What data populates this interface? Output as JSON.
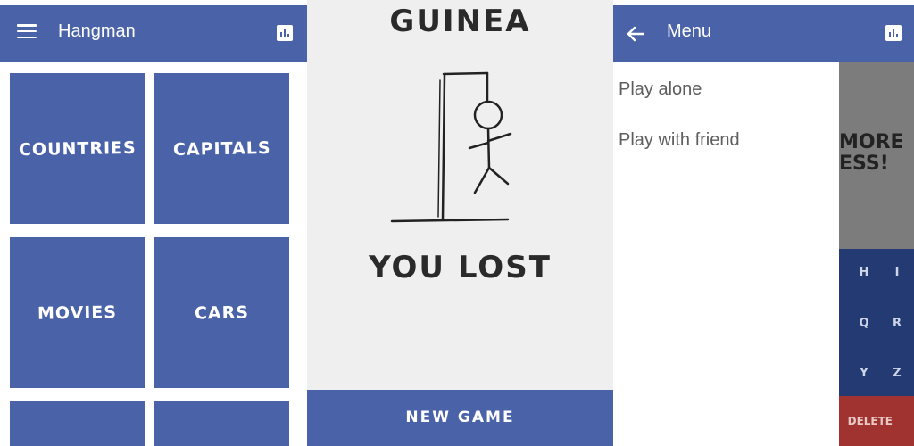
{
  "screen1": {
    "appbar": {
      "title": "Hangman",
      "menu_icon": "hamburger-icon",
      "stats_icon": "bar-chart-icon"
    },
    "categories": [
      "COUNTRIES",
      "CAPITALS",
      "MOVIES",
      "CARS",
      "",
      ""
    ]
  },
  "screen2": {
    "word": "GUINEA",
    "result": "YOU LOST",
    "new_game_label": "NEW GAME"
  },
  "screen3": {
    "appbar": {
      "title": "Menu",
      "back_icon": "arrow-left-icon",
      "stats_icon": "bar-chart-icon"
    },
    "menu_items": [
      "Play alone",
      "Play with friend"
    ],
    "background": {
      "text_line1": "MORE",
      "text_line2": "ESS!",
      "keys": [
        "H",
        "I",
        "Q",
        "R",
        "Y",
        "Z"
      ],
      "delete_label": "DELETE"
    }
  },
  "colors": {
    "primary": "#4a62a8",
    "background": "#efefef",
    "key_dark": "#243a72",
    "delete_red": "#a0332f"
  }
}
